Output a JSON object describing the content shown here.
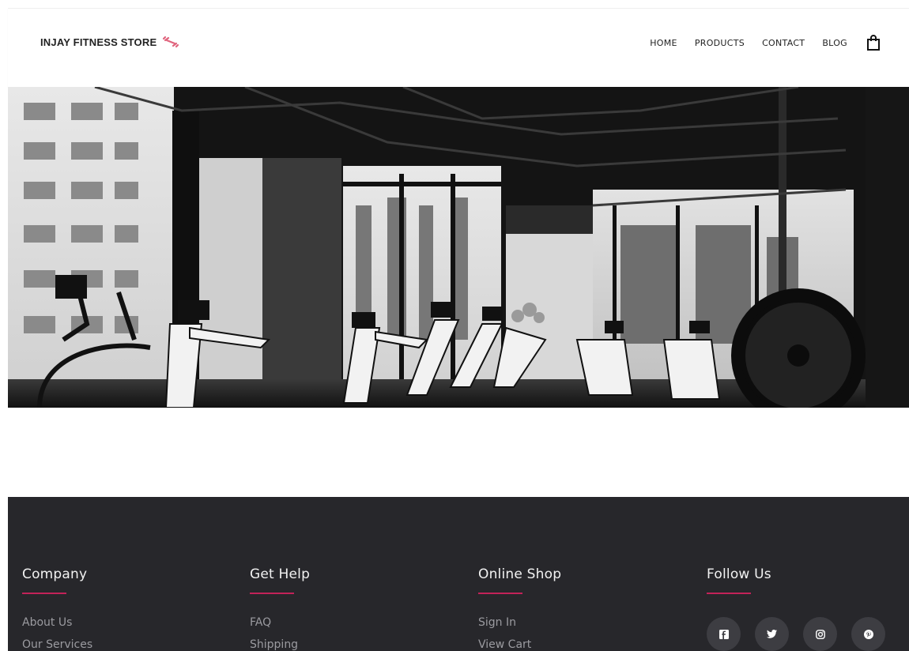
{
  "brand": {
    "name": "INJAY FITNESS STORE",
    "icon": "dumbbell-icon",
    "accent": "#e0647d"
  },
  "nav": {
    "items": [
      "HOME",
      "PRODUCTS",
      "CONTACT",
      "BLOG"
    ],
    "cart_icon": "shopping-bag-icon"
  },
  "hero": {
    "image": "gym-treadmills-photo-grayscale"
  },
  "footer": {
    "background": "#27272b",
    "accent": "#c22259",
    "columns": [
      {
        "title": "Company",
        "links": [
          "About Us",
          "Our Services"
        ]
      },
      {
        "title": "Get Help",
        "links": [
          "FAQ",
          "Shipping"
        ]
      },
      {
        "title": "Online Shop",
        "links": [
          "Sign In",
          "View Cart"
        ]
      },
      {
        "title": "Follow Us",
        "social": [
          "facebook-icon",
          "twitter-icon",
          "instagram-icon",
          "pinterest-icon"
        ]
      }
    ]
  }
}
